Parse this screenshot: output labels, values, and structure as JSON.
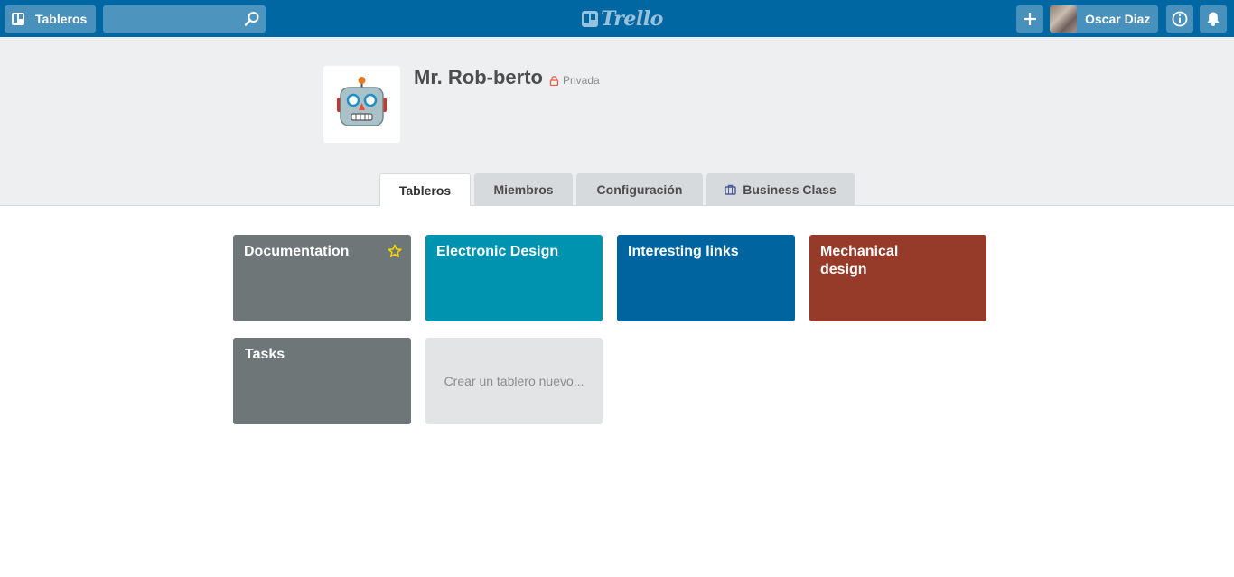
{
  "topbar": {
    "boards_label": "Tableros",
    "search_value": "",
    "logo_text": "Trello",
    "user_name": "Oscar Diaz"
  },
  "team": {
    "name": "Mr. Rob-berto",
    "privacy": "Privada"
  },
  "tabs": [
    {
      "label": "Tableros",
      "active": true
    },
    {
      "label": "Miembros",
      "active": false
    },
    {
      "label": "Configuración",
      "active": false
    },
    {
      "label": "Business Class",
      "active": false
    }
  ],
  "boards": [
    {
      "title": "Documentation",
      "color": "#6f7677",
      "starred": true
    },
    {
      "title": "Electronic Design",
      "color": "#0093b0",
      "starred": false
    },
    {
      "title": "Interesting links",
      "color": "#00659e",
      "starred": false
    },
    {
      "title": "Mechanical design",
      "color": "#963b29",
      "starred": false
    },
    {
      "title": "Tasks",
      "color": "#6f7677",
      "starred": false
    }
  ],
  "new_board_label": "Crear un tablero nuevo...",
  "colors": {
    "topbar": "#0067a3",
    "header_bg": "#edeff0",
    "star": "#f2d600",
    "lock": "#eb5a46"
  },
  "icons": {
    "boards": "boards-icon",
    "search": "search-icon",
    "add": "plus-icon",
    "info": "info-icon",
    "notifications": "bell-icon",
    "privacy": "lock-icon",
    "business_class": "briefcase-icon",
    "team_logo": "robot-icon",
    "star": "star-icon"
  }
}
